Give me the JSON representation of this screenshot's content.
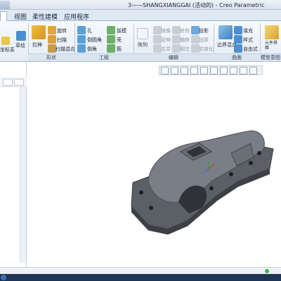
{
  "window": {
    "title": "3——SHANGXIANGGAI (活动的) - Creo Parametric"
  },
  "menu_tabs": [
    "视图",
    "柔性建模",
    "应用程序"
  ],
  "ribbon": {
    "datum_partial": [
      "坐标系"
    ],
    "base": {
      "stretch": "拉伸",
      "revolve": "旋转",
      "sweep": "扫描",
      "swept_blend": "扫描混合",
      "sketch": "草绘"
    },
    "engineering": {
      "hole": "孔",
      "round": "倒圆角",
      "chamfer": "倒角",
      "draft": "拔模",
      "shell": "壳",
      "rib": "筋"
    },
    "editing": {
      "pattern": "阵列",
      "mirror": "镜像",
      "extend": "延伸",
      "project": "投影",
      "trim": "修剪",
      "offset": "偏移",
      "thicken": "加厚",
      "merge": "合并",
      "intersect": "相交",
      "solidify": "实体化"
    },
    "surfaces": {
      "boundary_blend": "边界混合",
      "fill": "填充",
      "style": "样式",
      "freestyle": "自由式"
    },
    "model_intent": {
      "component_interface": "元件界面"
    },
    "groups": {
      "shapes": "形状",
      "engineering": "工程",
      "editing": "编辑",
      "surfaces": "曲面",
      "model_intent": "模型意图"
    }
  },
  "icons": [
    "zoom-fit-icon",
    "zoom-in-icon",
    "zoom-out-icon",
    "repaint-icon",
    "display-style-icon",
    "saved-view-icon",
    "section-view-icon",
    "datum-display-icon",
    "spin-center-icon",
    "annotation-icon"
  ],
  "colors": {
    "model": "#5b5f66",
    "model_light": "#7a7e86",
    "model_dark": "#3c3f44",
    "ribbon_bg": "#e4ecf5",
    "accent": "#2f6fb3"
  }
}
